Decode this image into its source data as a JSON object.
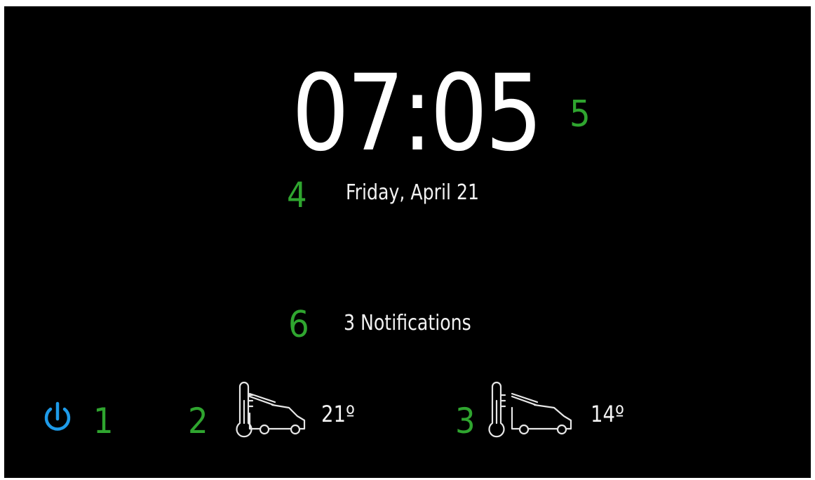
{
  "clock": {
    "time": "07:05",
    "marker": "5"
  },
  "date": {
    "text": "Friday, April 21",
    "marker": "4"
  },
  "notifications": {
    "text": "3 Notifications",
    "marker": "6"
  },
  "bottom_bar": {
    "power": {
      "icon": "power-icon",
      "color": "#1e9be9",
      "marker": "1"
    },
    "climate_left": {
      "icon": "thermometer-vehicle-icon",
      "temperature": "21º",
      "marker": "2"
    },
    "climate_right": {
      "icon": "thermometer-vehicle-icon",
      "temperature": "14º",
      "marker": "3"
    }
  },
  "colors": {
    "background": "#000000",
    "text": "#ffffff",
    "marker": "#2fa52f",
    "accent": "#1e9be9"
  }
}
